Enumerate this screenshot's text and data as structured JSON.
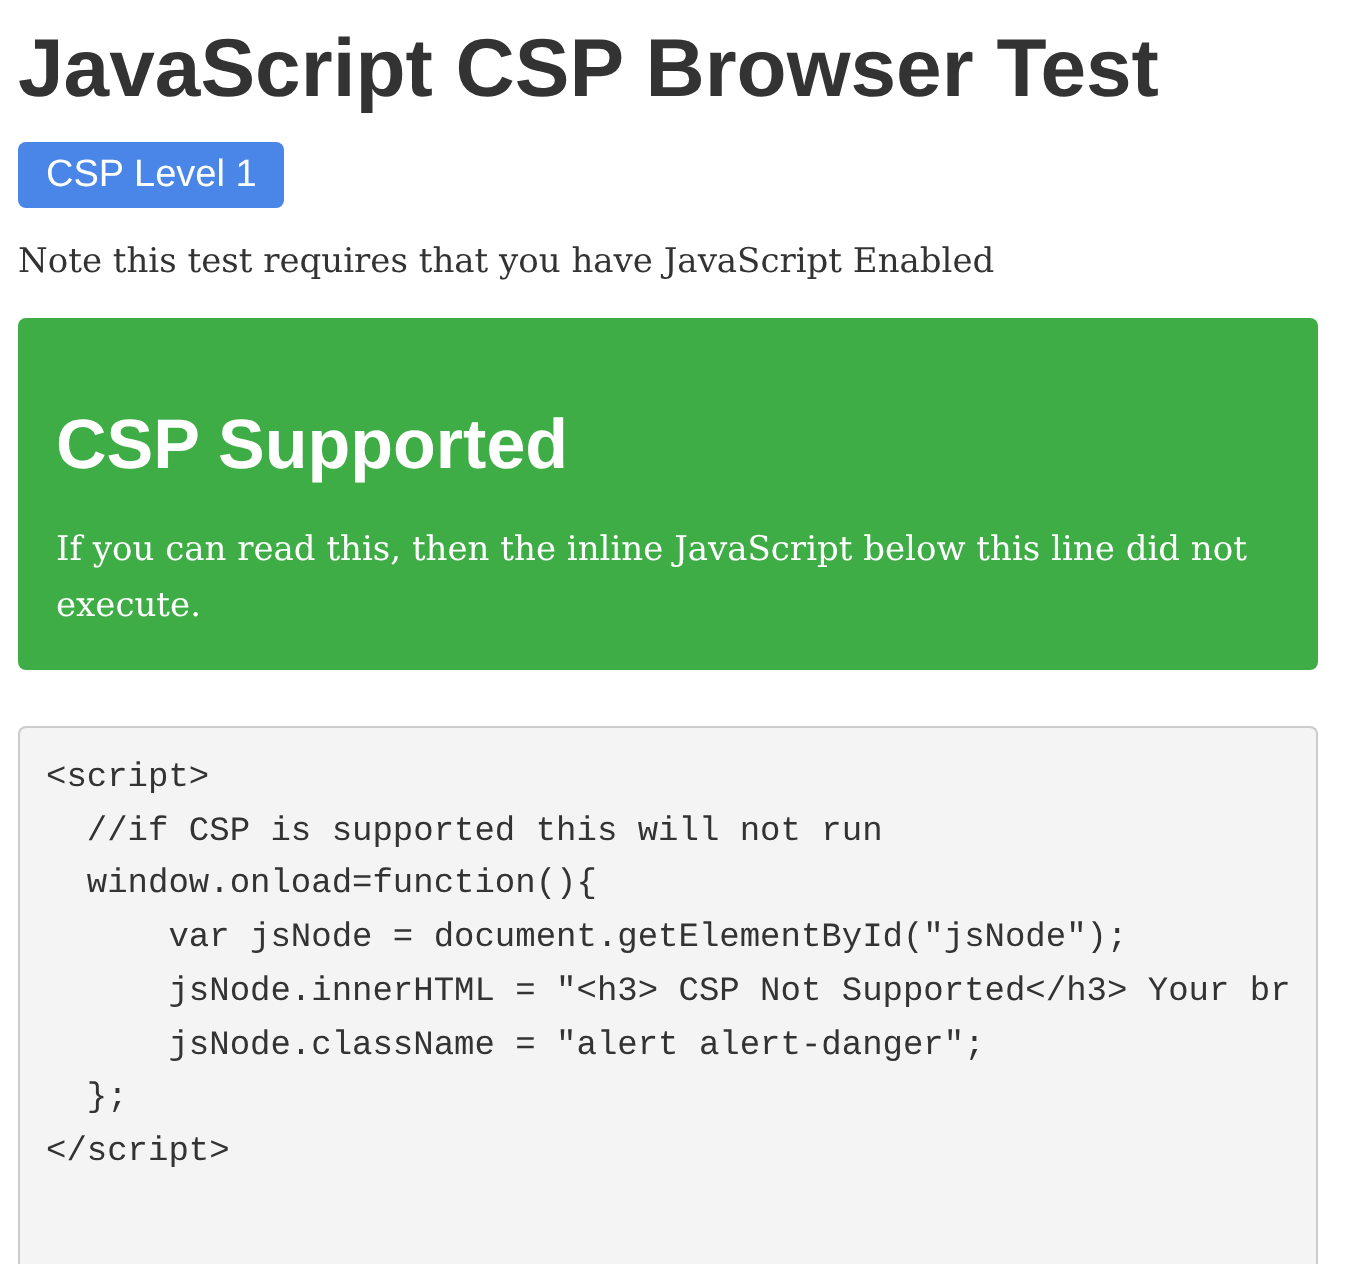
{
  "page": {
    "title": "JavaScript CSP Browser Test",
    "badge": "CSP Level 1",
    "note": "Note this test requires that you have JavaScript Enabled"
  },
  "alert": {
    "title": "CSP Supported",
    "message": "If you can read this, then the inline JavaScript below this line did not execute."
  },
  "code_block": {
    "lines": [
      "<script>",
      "  //if CSP is supported this will not run",
      "  window.onload=function(){",
      "      var jsNode = document.getElementById(\"jsNode\");",
      "      jsNode.innerHTML = \"<h3> CSP Not Supported</h3> Your br",
      "      jsNode.className = \"alert alert-danger\";",
      "  };",
      "</script>"
    ]
  }
}
